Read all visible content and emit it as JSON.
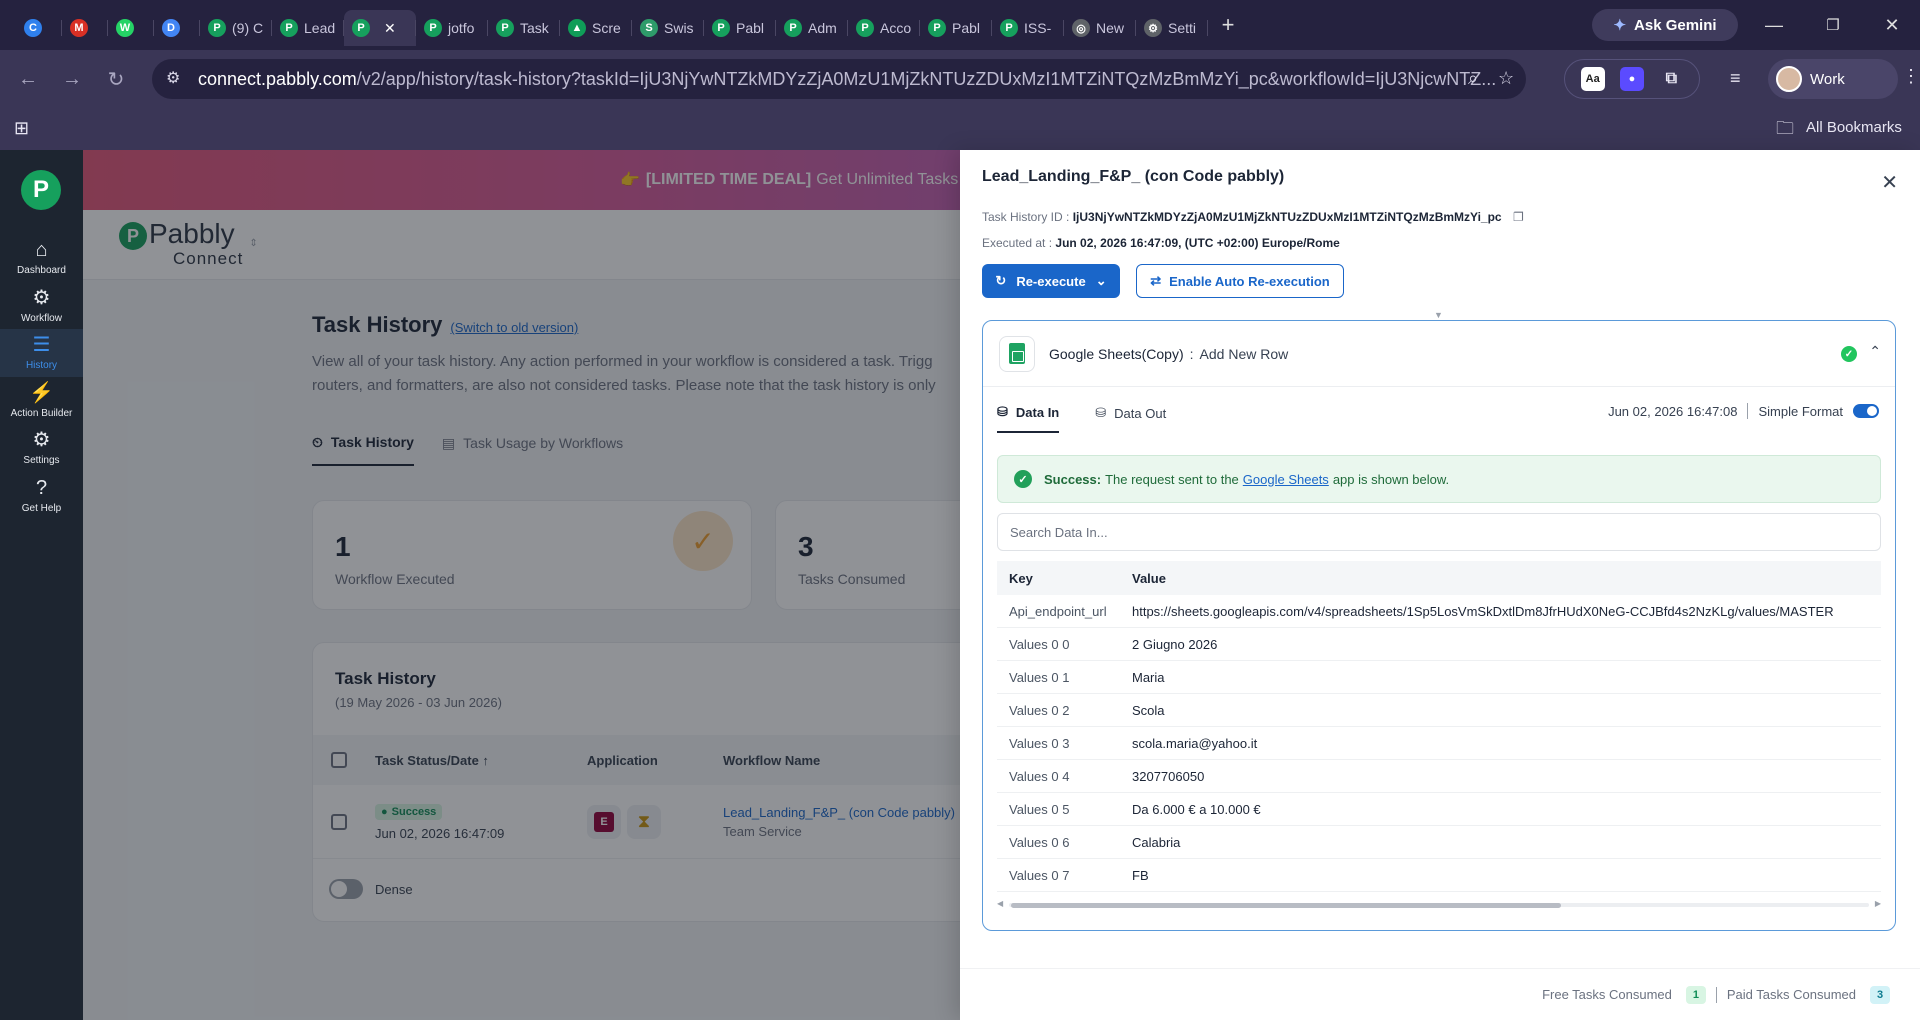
{
  "browser": {
    "tabs": [
      {
        "label": "",
        "fav": "C",
        "color": "#2f80ed"
      },
      {
        "label": "",
        "fav": "M",
        "color": "#d93025"
      },
      {
        "label": "",
        "fav": "W",
        "color": "#25d366"
      },
      {
        "label": "",
        "fav": "D",
        "color": "#4285f4"
      },
      {
        "label": "(9) C",
        "fav": "P",
        "color": "#16a05d"
      },
      {
        "label": "Lead",
        "fav": "P",
        "color": "#16a05d"
      },
      {
        "label": "",
        "fav": "P",
        "color": "#16a05d",
        "active": true
      },
      {
        "label": "jotfo",
        "fav": "P",
        "color": "#16a05d"
      },
      {
        "label": "Task",
        "fav": "P",
        "color": "#16a05d"
      },
      {
        "label": "Scre",
        "fav": "▲",
        "color": "#0f9d58"
      },
      {
        "label": "Swis",
        "fav": "S",
        "color": "#2e9b6a"
      },
      {
        "label": "Pabl",
        "fav": "P",
        "color": "#16a05d"
      },
      {
        "label": "Adm",
        "fav": "P",
        "color": "#16a05d"
      },
      {
        "label": "Acco",
        "fav": "P",
        "color": "#16a05d"
      },
      {
        "label": "Pabl",
        "fav": "P",
        "color": "#16a05d"
      },
      {
        "label": "ISS-",
        "fav": "P",
        "color": "#16a05d"
      },
      {
        "label": "New",
        "fav": "◎",
        "color": "#5f6368"
      },
      {
        "label": "Setti",
        "fav": "⚙",
        "color": "#5f6368"
      }
    ],
    "gemini_label": "Ask Gemini",
    "url_host": "connect.pabbly.com",
    "url_rest": "/v2/app/history/task-history?taskId=IjU3NjYwNTZkMDYzZjA0MzU1MjZkNTUzZDUxMzI1MTZiNTQzMzBmMzYi_pc&workflowId=IjU3NjcwNTZ...",
    "profile_label": "Work",
    "bookmarks_label": "All Bookmarks"
  },
  "sidebar": {
    "logo": "P",
    "items": [
      {
        "label": "Dashboard",
        "icon": "home-icon",
        "glyph": "⌂"
      },
      {
        "label": "Workflow",
        "icon": "workflow-icon",
        "glyph": "⚙"
      },
      {
        "label": "History",
        "icon": "history-icon",
        "glyph": "☰",
        "active": true
      },
      {
        "label": "Action Builder",
        "icon": "bolt-icon",
        "glyph": "⚡"
      },
      {
        "label": "Settings",
        "icon": "gear-icon",
        "glyph": "⚙"
      },
      {
        "label": "Get Help",
        "icon": "help-icon",
        "glyph": "?"
      }
    ]
  },
  "banner": {
    "emoji": "👉",
    "bold": "[LIMITED TIME DEAL]",
    "text": "Get Unlimited Tasks wi"
  },
  "brand": {
    "name": "Pabbly",
    "sub": "Connect"
  },
  "page": {
    "title": "Task History",
    "switch_link": "(Switch to old version)",
    "desc": "View all of your task history. Any action performed in your workflow is considered a task. Trigg routers, and formatters, are also not considered tasks. Please note that the task history is only",
    "tabs": [
      {
        "label": "Task History",
        "active": true
      },
      {
        "label": "Task Usage by Workflows"
      }
    ],
    "stats": [
      {
        "num": "1",
        "label": "Workflow Executed"
      },
      {
        "num": "3",
        "label": "Tasks Consumed"
      }
    ],
    "history_card": {
      "title": "Task History",
      "subtitle": "(19 May 2026 - 03 Jun 2026)",
      "columns": [
        "Task Status/Date",
        "Application",
        "Workflow Name"
      ],
      "row": {
        "status": "Success",
        "date": "Jun 02, 2026 16:47:09",
        "workflow": "Lead_Landing_F&P_ (con Code pabbly)",
        "team": "Team Service"
      },
      "dense_label": "Dense"
    }
  },
  "drawer": {
    "title": "Lead_Landing_F&P_ (con Code pabbly)",
    "task_id_label": "Task History ID :",
    "task_id": "IjU3NjYwNTZkMDYzZjA0MzU1MjZkNTUzZDUxMzI1MTZiNTQzMzBmMzYi_pc",
    "executed_label": "Executed at :",
    "executed_at": "Jun 02, 2026 16:47:09, (UTC +02:00) Europe/Rome",
    "reexecute_label": "Re-execute",
    "auto_label": "Enable Auto Re-execution",
    "step": {
      "app": "Google Sheets(Copy)",
      "sep": ":",
      "action": "Add New Row",
      "tabs": [
        "Data In",
        "Data Out"
      ],
      "timestamp": "Jun 02, 2026 16:47:08",
      "format_label": "Simple Format",
      "alert_bold": "Success:",
      "alert_pre": "The request sent to the",
      "alert_link": "Google Sheets",
      "alert_post": "app is shown below.",
      "search_placeholder": "Search Data In...",
      "table_headers": [
        "Key",
        "Value"
      ],
      "rows": [
        {
          "k": "Api_endpoint_url",
          "v": "https://sheets.googleapis.com/v4/spreadsheets/1Sp5LosVmSkDxtlDm8JfrHUdX0NeG-CCJBfd4s2NzKLg/values/MASTER"
        },
        {
          "k": "Values 0 0",
          "v": "2 Giugno 2026"
        },
        {
          "k": "Values 0 1",
          "v": "Maria"
        },
        {
          "k": "Values 0 2",
          "v": "Scola"
        },
        {
          "k": "Values 0 3",
          "v": "scola.maria@yahoo.it"
        },
        {
          "k": "Values 0 4",
          "v": "3207706050"
        },
        {
          "k": "Values 0 5",
          "v": "Da 6.000 € a 10.000 €"
        },
        {
          "k": "Values 0 6",
          "v": "Calabria"
        },
        {
          "k": "Values 0 7",
          "v": "FB"
        }
      ]
    },
    "footer": {
      "free_label": "Free Tasks Consumed",
      "free_count": "1",
      "paid_label": "Paid Tasks Consumed",
      "paid_count": "3"
    }
  }
}
